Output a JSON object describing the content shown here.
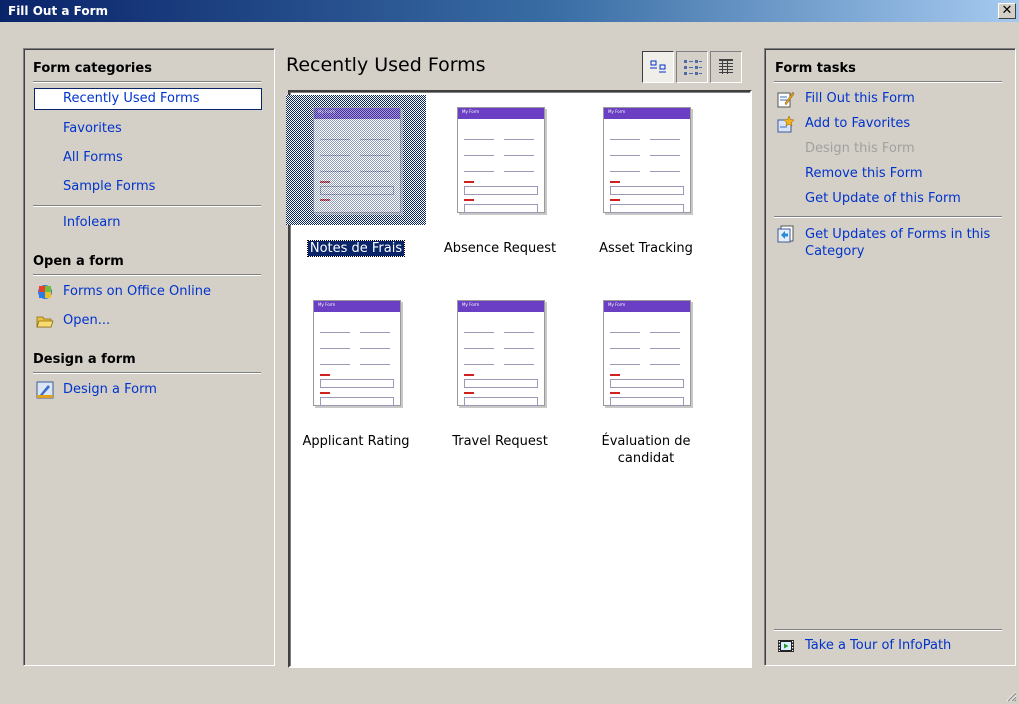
{
  "window": {
    "title": "Fill Out a Form",
    "close_glyph": "✕"
  },
  "left": {
    "categories_heading": "Form categories",
    "categories": [
      "Recently Used Forms",
      "Favorites",
      "All Forms",
      "Sample Forms"
    ],
    "infolearn": "Infolearn",
    "open_heading": "Open a form",
    "open_items": [
      {
        "label": "Forms on Office Online",
        "icon": "office-online-icon"
      },
      {
        "label": "Open...",
        "icon": "open-folder-icon"
      }
    ],
    "design_heading": "Design a form",
    "design_items": [
      {
        "label": "Design a Form",
        "icon": "design-form-icon"
      }
    ]
  },
  "main": {
    "title": "Recently Used Forms",
    "view_buttons": [
      "large-icons-view",
      "tiles-view",
      "details-view"
    ],
    "forms": [
      {
        "label": "Notes de Frais",
        "selected": true
      },
      {
        "label": "Absence Request",
        "selected": false
      },
      {
        "label": "Asset Tracking",
        "selected": false
      },
      {
        "label": "Applicant Rating",
        "selected": false
      },
      {
        "label": "Travel Request",
        "selected": false
      },
      {
        "label": "Évaluation de candidat",
        "selected": false
      }
    ],
    "thumb_header": "My Form"
  },
  "right": {
    "tasks_heading": "Form tasks",
    "tasks": [
      {
        "label": "Fill Out this Form",
        "enabled": true,
        "icon": "fill-out-icon"
      },
      {
        "label": "Add to Favorites",
        "enabled": true,
        "icon": "add-favorites-icon"
      },
      {
        "label": "Design this Form",
        "enabled": false
      },
      {
        "label": "Remove this Form",
        "enabled": true
      },
      {
        "label": "Get Update of this Form",
        "enabled": true
      }
    ],
    "category_task": "Get Updates of Forms in this Category",
    "tour": "Take a Tour of InfoPath"
  },
  "colors": {
    "link": "#0033cc",
    "selection": "#0a246a",
    "form_header": "#6a3fc3"
  }
}
